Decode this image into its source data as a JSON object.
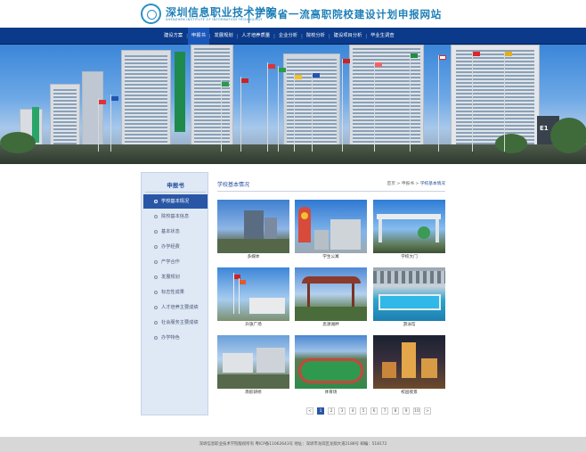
{
  "header": {
    "school_name": "深圳信息职业技术学院",
    "school_en": "SHENZHEN INSTITUTE OF INFORMATION TECHNOLOGY",
    "site_title": "广东省一流高职院校建设计划申报网站"
  },
  "nav": {
    "items": [
      {
        "label": "建设方案"
      },
      {
        "label": "申报书"
      },
      {
        "label": "发展规划"
      },
      {
        "label": "人才培养质量"
      },
      {
        "label": "企业分析"
      },
      {
        "label": "院校分析"
      },
      {
        "label": "建设项目分析"
      },
      {
        "label": "毕业生调查"
      }
    ]
  },
  "banner": {
    "sign_text": "E1"
  },
  "sidebar": {
    "title": "申报书",
    "items": [
      {
        "label": "学校基本情况"
      },
      {
        "label": "院校基本信息"
      },
      {
        "label": "基本状态"
      },
      {
        "label": "办学经费"
      },
      {
        "label": "产学合作"
      },
      {
        "label": "发展规划"
      },
      {
        "label": "标志性成果"
      },
      {
        "label": "人才培养主要成绩"
      },
      {
        "label": "社会服务主要成绩"
      },
      {
        "label": "办学特色"
      }
    ]
  },
  "content": {
    "title": "学校基本情况",
    "breadcrumb": {
      "home": "首页",
      "sep1": " > ",
      "section": "申报书",
      "sep2": " > ",
      "current": "学校基本情况"
    }
  },
  "gallery": [
    {
      "caption": "多媒体"
    },
    {
      "caption": "学生公寓"
    },
    {
      "caption": "学校大门"
    },
    {
      "caption": "升旗广场"
    },
    {
      "caption": "思源湖畔"
    },
    {
      "caption": "游泳馆"
    },
    {
      "caption": "南航研修"
    },
    {
      "caption": "体育场"
    },
    {
      "caption": "校园夜景"
    }
  ],
  "pager": {
    "prev": "<",
    "pages": [
      "1",
      "2",
      "3",
      "4",
      "5",
      "6",
      "7",
      "8",
      "9",
      "10"
    ],
    "next": ">",
    "current": "1"
  },
  "footer": {
    "text": "深圳信息职业技术学院版权所有   粤ICP备11062643号   地址：深圳市龙岗区龙翔大道2188号 邮编：518172"
  }
}
